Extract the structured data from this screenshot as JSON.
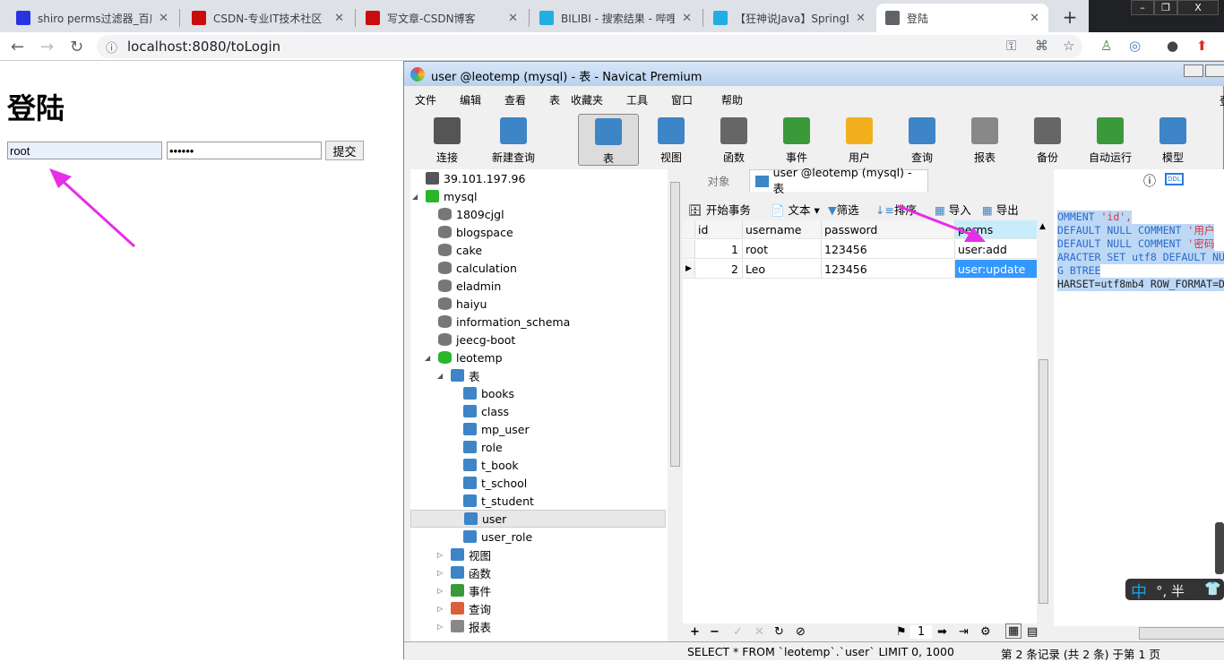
{
  "browser": {
    "tabs": [
      {
        "title": "shiro perms过滤器_百度",
        "icon": "baidu-icon",
        "color": "#2932e1"
      },
      {
        "title": "CSDN-专业IT技术社区",
        "icon": "csdn-icon",
        "color": "#c90d0d"
      },
      {
        "title": "写文章-CSDN博客",
        "icon": "csdn-icon",
        "color": "#c90d0d"
      },
      {
        "title": "BILIBI - 搜索结果 - 哔哩",
        "icon": "bilibili-icon",
        "color": "#23ade5"
      },
      {
        "title": "【狂神说Java】SpringB",
        "icon": "bilibili-icon",
        "color": "#23ade5"
      },
      {
        "title": "登陆",
        "icon": "globe-icon",
        "color": "#5f6368"
      }
    ],
    "url": "localhost:8080/toLogin"
  },
  "page": {
    "title": "登陆",
    "username": "root",
    "password": "••••••",
    "submit": "提交"
  },
  "navicat": {
    "title": "user @leotemp (mysql) - 表 - Navicat Premium",
    "menu": [
      "文件",
      "编辑",
      "查看",
      "表",
      "收藏夹",
      "工具",
      "窗口",
      "帮助"
    ],
    "toolbar": [
      {
        "label": "连接",
        "icon": "connect-icon",
        "color": "#555"
      },
      {
        "label": "新建查询",
        "icon": "new-query-icon",
        "color": "#3d85c6"
      },
      {
        "label": "表",
        "icon": "table-icon",
        "color": "#3d85c6"
      },
      {
        "label": "视图",
        "icon": "view-icon",
        "color": "#3d85c6"
      },
      {
        "label": "函数",
        "icon": "function-icon",
        "color": "#666"
      },
      {
        "label": "事件",
        "icon": "event-icon",
        "color": "#3a9a3a"
      },
      {
        "label": "用户",
        "icon": "user-icon",
        "color": "#f2b01e"
      },
      {
        "label": "查询",
        "icon": "query-icon",
        "color": "#3d85c6"
      },
      {
        "label": "报表",
        "icon": "report-icon",
        "color": "#888"
      },
      {
        "label": "备份",
        "icon": "backup-icon",
        "color": "#666"
      },
      {
        "label": "自动运行",
        "icon": "automation-icon",
        "color": "#3a9a3a"
      },
      {
        "label": "模型",
        "icon": "model-icon",
        "color": "#3d85c6"
      }
    ],
    "tree": [
      {
        "label": "39.101.197.96",
        "level": 0,
        "kind": "connection"
      },
      {
        "label": "mysql",
        "level": 0,
        "kind": "connection-open",
        "expanded": true
      },
      {
        "label": "1809cjgl",
        "level": 1,
        "kind": "database"
      },
      {
        "label": "blogspace",
        "level": 1,
        "kind": "database"
      },
      {
        "label": "cake",
        "level": 1,
        "kind": "database"
      },
      {
        "label": "calculation",
        "level": 1,
        "kind": "database"
      },
      {
        "label": "eladmin",
        "level": 1,
        "kind": "database"
      },
      {
        "label": "haiyu",
        "level": 1,
        "kind": "database"
      },
      {
        "label": "information_schema",
        "level": 1,
        "kind": "database"
      },
      {
        "label": "jeecg-boot",
        "level": 1,
        "kind": "database"
      },
      {
        "label": "leotemp",
        "level": 1,
        "kind": "database-open",
        "expanded": true
      },
      {
        "label": "表",
        "level": 2,
        "kind": "table-group",
        "expanded": true
      },
      {
        "label": "books",
        "level": 3,
        "kind": "table"
      },
      {
        "label": "class",
        "level": 3,
        "kind": "table"
      },
      {
        "label": "mp_user",
        "level": 3,
        "kind": "table"
      },
      {
        "label": "role",
        "level": 3,
        "kind": "table"
      },
      {
        "label": "t_book",
        "level": 3,
        "kind": "table"
      },
      {
        "label": "t_school",
        "level": 3,
        "kind": "table"
      },
      {
        "label": "t_student",
        "level": 3,
        "kind": "table"
      },
      {
        "label": "user",
        "level": 3,
        "kind": "table",
        "selected": true
      },
      {
        "label": "user_role",
        "level": 3,
        "kind": "table"
      },
      {
        "label": "视图",
        "level": 2,
        "kind": "view-group"
      },
      {
        "label": "函数",
        "level": 2,
        "kind": "function-group"
      },
      {
        "label": "事件",
        "level": 2,
        "kind": "event-group"
      },
      {
        "label": "查询",
        "level": 2,
        "kind": "query-group"
      },
      {
        "label": "报表",
        "level": 2,
        "kind": "report-group"
      }
    ],
    "object_tabs": {
      "objects": "对象",
      "table_tab": "user @leotemp (mysql) - 表"
    },
    "data_toolbar": {
      "begin_tx": "开始事务",
      "text": "文本",
      "filter": "筛选",
      "sort": "排序",
      "import": "导入",
      "export": "导出"
    },
    "grid": {
      "columns": [
        "id",
        "username",
        "password",
        "perms"
      ],
      "rows": [
        [
          "1",
          "root",
          "123456",
          "user:add"
        ],
        [
          "2",
          "Leo",
          "123456",
          "user:update"
        ]
      ]
    },
    "page_number": "1",
    "ddl": [
      {
        "kw": "OMMENT ",
        "str": "'id',"
      },
      {
        "kw": " DEFAULT NULL COMMENT ",
        "str": "'用户"
      },
      {
        "kw": " DEFAULT NULL COMMENT ",
        "str": "'密码"
      },
      {
        "kw": "ARACTER SET utf8 DEFAULT NU",
        "str": ""
      },
      {
        "kw": "G BTREE",
        "str": ""
      },
      {
        "kw": "HARSET=utf8mb4 ROW_FORMAT=D",
        "str": ""
      }
    ],
    "status": {
      "sql": "SELECT * FROM `leotemp`.`user` LIMIT 0, 1000",
      "records": "第 2 条记录 (共 2 条) 于第 1 页"
    },
    "menu_right": "登"
  },
  "ime": {
    "label": "中",
    "extra": "°, 半"
  }
}
